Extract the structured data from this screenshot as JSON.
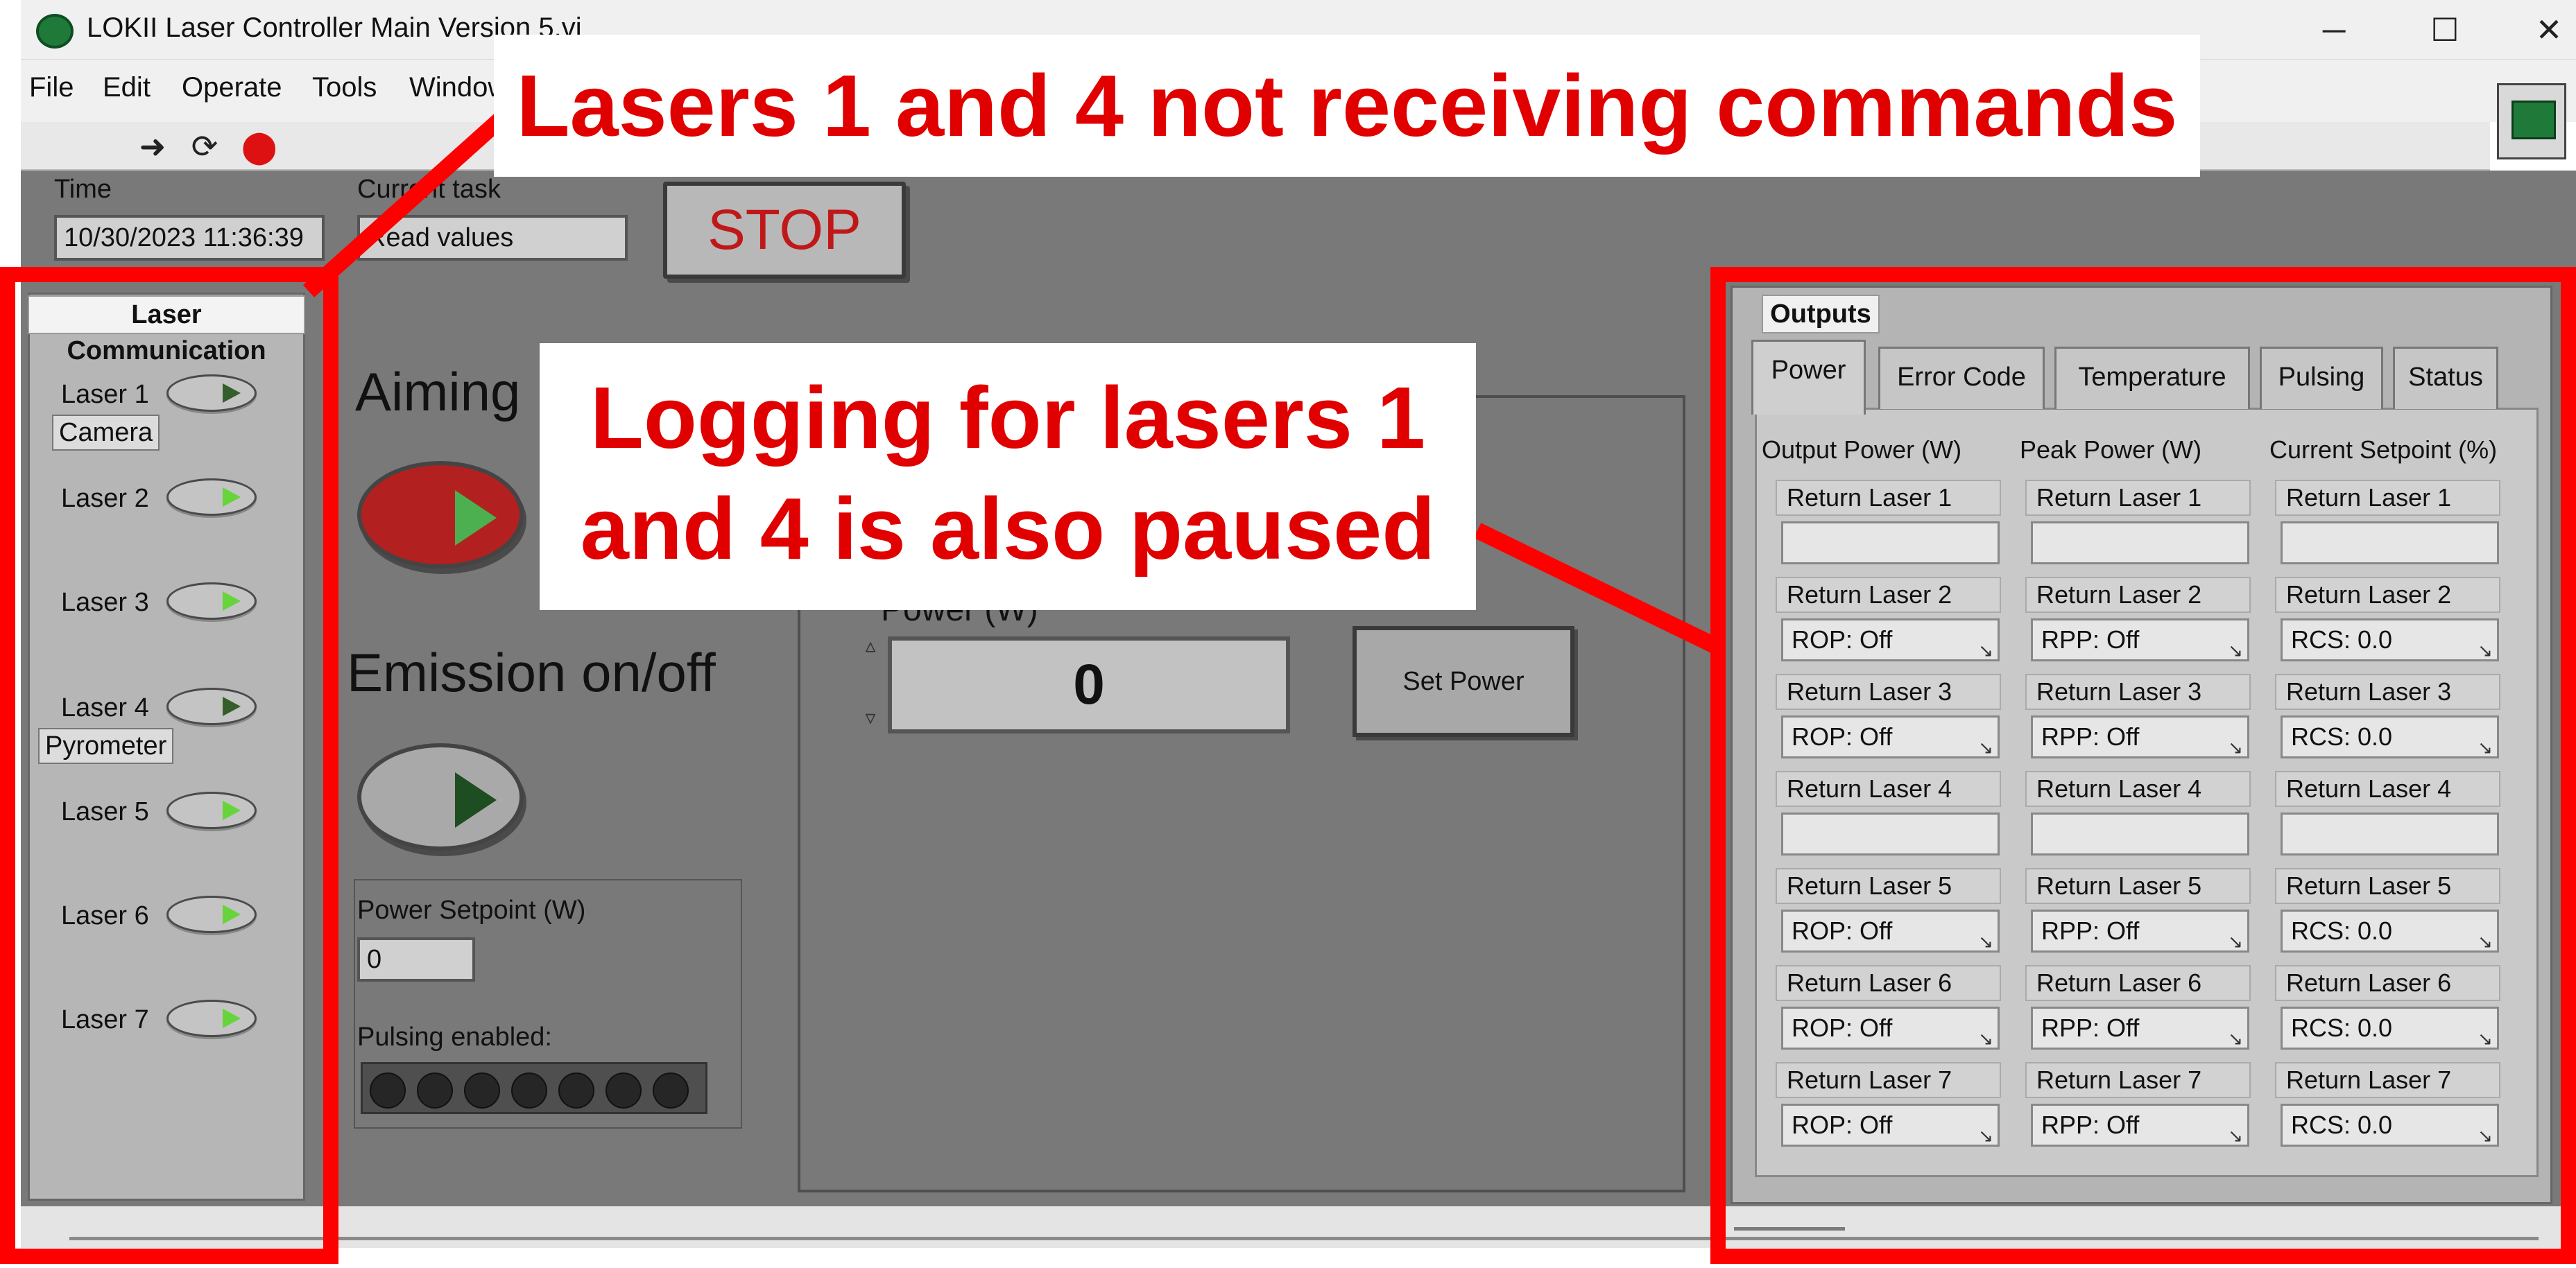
{
  "window": {
    "title": "LOKII Laser Controller Main Version 5.vi",
    "minimize": "─",
    "maximize": "☐",
    "close": "✕"
  },
  "menu": [
    "File",
    "Edit",
    "Operate",
    "Tools",
    "Window"
  ],
  "toolbar": {
    "run_icon": "run-arrow-icon",
    "run_continuously_icon": "run-continuously-icon",
    "abort_icon": "abort-icon"
  },
  "header": {
    "time_label": "Time",
    "time_value": "10/30/2023 11:36:39",
    "task_label": "Current task",
    "task_value": "Read values",
    "stop_label": "STOP"
  },
  "laser_communication": {
    "title": "Laser Communication",
    "lasers": [
      {
        "label": "Laser 1",
        "tag": "Camera",
        "state": "dim"
      },
      {
        "label": "Laser 2",
        "tag": "",
        "state": "on"
      },
      {
        "label": "Laser 3",
        "tag": "",
        "state": "on"
      },
      {
        "label": "Laser 4",
        "tag": "Pyrometer",
        "state": "dim"
      },
      {
        "label": "Laser 5",
        "tag": "",
        "state": "on"
      },
      {
        "label": "Laser 6",
        "tag": "",
        "state": "on"
      },
      {
        "label": "Laser 7",
        "tag": "",
        "state": "on"
      }
    ]
  },
  "controls": {
    "aiming_label": "Aiming",
    "emission_label": "Emission on/off",
    "power_setpoint_label": "Power Setpoint (W)",
    "power_setpoint_value": "0",
    "pulsing_label": "Pulsing enabled:",
    "power_label": "Power (W)",
    "power_value": "0",
    "set_power_label": "Set Power"
  },
  "outputs": {
    "title": "Outputs",
    "tabs": [
      "Power",
      "Error Code",
      "Temperature",
      "Pulsing",
      "Status"
    ],
    "active_tab": "Power",
    "columns": [
      {
        "header": "Output Power (W)",
        "rows": [
          {
            "label": "Return Laser 1",
            "value": ""
          },
          {
            "label": "Return Laser 2",
            "value": "ROP: Off"
          },
          {
            "label": "Return Laser 3",
            "value": "ROP: Off"
          },
          {
            "label": "Return Laser 4",
            "value": ""
          },
          {
            "label": "Return Laser 5",
            "value": "ROP: Off"
          },
          {
            "label": "Return Laser 6",
            "value": "ROP: Off"
          },
          {
            "label": "Return Laser 7",
            "value": "ROP: Off"
          }
        ]
      },
      {
        "header": "Peak Power (W)",
        "rows": [
          {
            "label": "Return Laser 1",
            "value": ""
          },
          {
            "label": "Return Laser 2",
            "value": "RPP: Off"
          },
          {
            "label": "Return Laser 3",
            "value": "RPP: Off"
          },
          {
            "label": "Return Laser 4",
            "value": ""
          },
          {
            "label": "Return Laser 5",
            "value": "RPP: Off"
          },
          {
            "label": "Return Laser 6",
            "value": "RPP: Off"
          },
          {
            "label": "Return Laser 7",
            "value": "RPP: Off"
          }
        ]
      },
      {
        "header": "Current Setpoint (%)",
        "rows": [
          {
            "label": "Return Laser 1",
            "value": ""
          },
          {
            "label": "Return Laser 2",
            "value": "RCS: 0.0"
          },
          {
            "label": "Return Laser 3",
            "value": "RCS: 0.0"
          },
          {
            "label": "Return Laser 4",
            "value": ""
          },
          {
            "label": "Return Laser 5",
            "value": "RCS: 0.0"
          },
          {
            "label": "Return Laser 6",
            "value": "RCS: 0.0"
          },
          {
            "label": "Return Laser 7",
            "value": "RCS: 0.0"
          }
        ]
      }
    ]
  },
  "annotations": {
    "top_callout": "Lasers 1 and 4 not receiving commands",
    "middle_callout_line1": "Logging for lasers 1",
    "middle_callout_line2": "and 4 is also paused"
  },
  "colors": {
    "panel_gray": "#797979",
    "annotation_red": "#ff0000",
    "callout_text_red": "#e00000",
    "led_on": "#66d43a",
    "led_dim": "#355f2a",
    "stop_text": "#c01818"
  }
}
